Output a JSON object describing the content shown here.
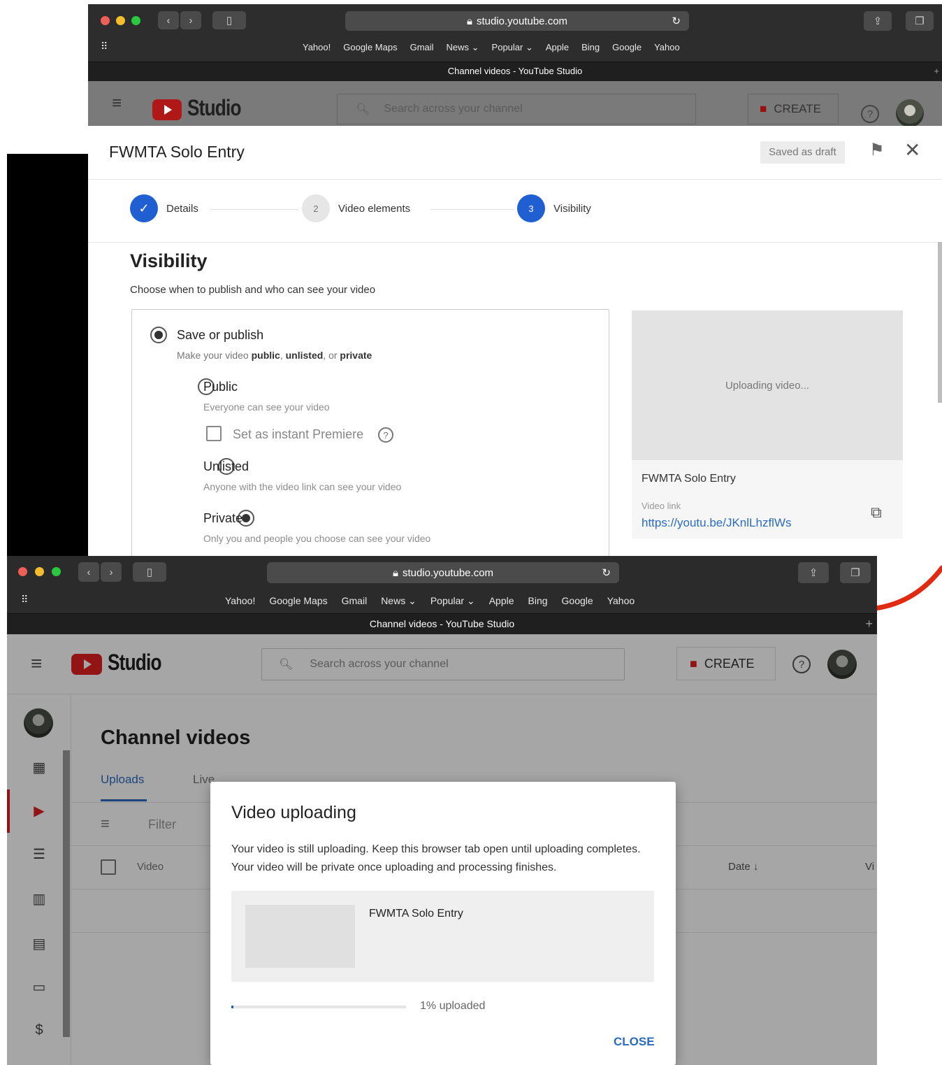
{
  "browser": {
    "url": "studio.youtube.com",
    "bookmarks": [
      "Yahoo!",
      "Google Maps",
      "Gmail",
      "News ⌄",
      "Popular ⌄",
      "Apple",
      "Bing",
      "Google",
      "Yahoo"
    ],
    "tab_title": "Channel videos - YouTube Studio"
  },
  "studio": {
    "logo_text": "Studio",
    "search_placeholder": "Search across your channel",
    "create_label": "CREATE"
  },
  "upload_dialog": {
    "title": "FWMTA Solo Entry",
    "draft_badge": "Saved as draft",
    "steps": [
      {
        "number": "✓",
        "label": "Details"
      },
      {
        "number": "2",
        "label": "Video elements"
      },
      {
        "number": "3",
        "label": "Visibility"
      }
    ],
    "section_title": "Visibility",
    "section_subtitle": "Choose when to publish and who can see your video",
    "save_publish": {
      "label": "Save or publish",
      "desc_prefix": "Make your video ",
      "desc_public": "public",
      "desc_sep1": ", ",
      "desc_unlisted": "unlisted",
      "desc_sep2": ", or ",
      "desc_private": "private"
    },
    "options": {
      "public_label": "Public",
      "public_desc": "Everyone can see your video",
      "premiere_label": "Set as instant Premiere",
      "unlisted_label": "Unlisted",
      "unlisted_desc": "Anyone with the video link can see your video",
      "private_label": "Private",
      "private_desc": "Only you and people you choose can see your video"
    },
    "preview": {
      "status": "Uploading video...",
      "video_title": "FWMTA Solo Entry",
      "link_label": "Video link",
      "link": "https://youtu.be/JKnlLhzflWs"
    }
  },
  "channel": {
    "title": "Channel videos",
    "tabs": [
      "Uploads",
      "Live"
    ],
    "filter_label": "Filter",
    "col_video": "Video",
    "col_date": "Date ↓",
    "col_views": "Vi"
  },
  "modal": {
    "title": "Video uploading",
    "body": "Your video is still uploading. Keep this browser tab open until uploading completes. Your video will be private once uploading and processing finishes.",
    "video_title": "FWMTA Solo Entry",
    "progress_text": "1% uploaded",
    "progress_value": 0.01,
    "close_label": "CLOSE"
  },
  "colors": {
    "yt_red": "#e02020",
    "link_blue": "#2a6bc0",
    "step_blue": "#1f5fd1"
  }
}
